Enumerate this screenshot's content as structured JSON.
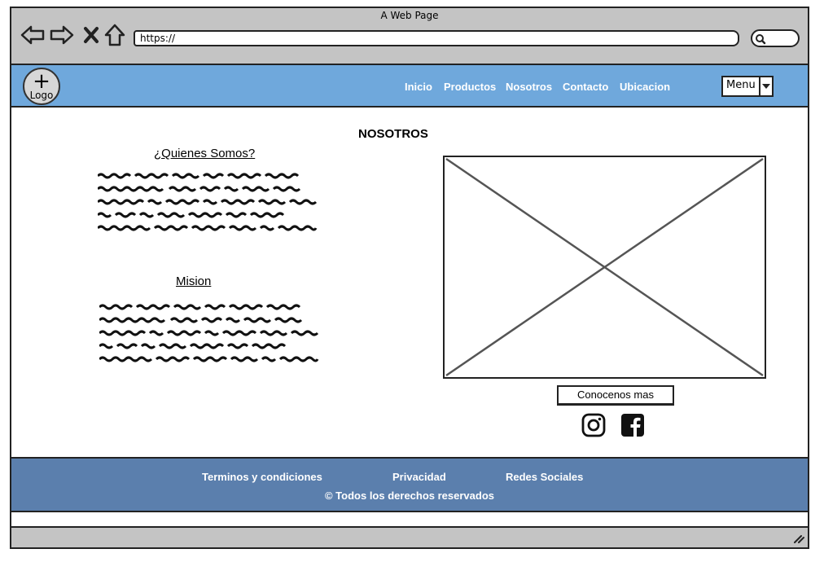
{
  "window": {
    "title": "A Web Page"
  },
  "browser": {
    "url": "https://",
    "icons": [
      "back-arrow-icon",
      "forward-arrow-icon",
      "close-icon",
      "home-icon",
      "search-icon"
    ]
  },
  "header": {
    "logo_text": "Logo",
    "nav": [
      "Inicio",
      "Productos",
      "Nosotros",
      "Contacto",
      "Ubicacion"
    ],
    "menu_label": "Menu",
    "bg_color": "#6fa8dc"
  },
  "main": {
    "page_title": "NOSOTROS",
    "sections": [
      {
        "title": "¿Quienes Somos?"
      },
      {
        "title": "Mision"
      }
    ],
    "cta_label": "Conocenos mas",
    "social_icons": [
      "instagram-icon",
      "facebook-icon"
    ]
  },
  "footer": {
    "links": [
      "Terminos y condiciones",
      "Privacidad",
      "Redes Sociales"
    ],
    "copyright": "© Todos los derechos reservados",
    "bg_color": "#5b7fad"
  }
}
